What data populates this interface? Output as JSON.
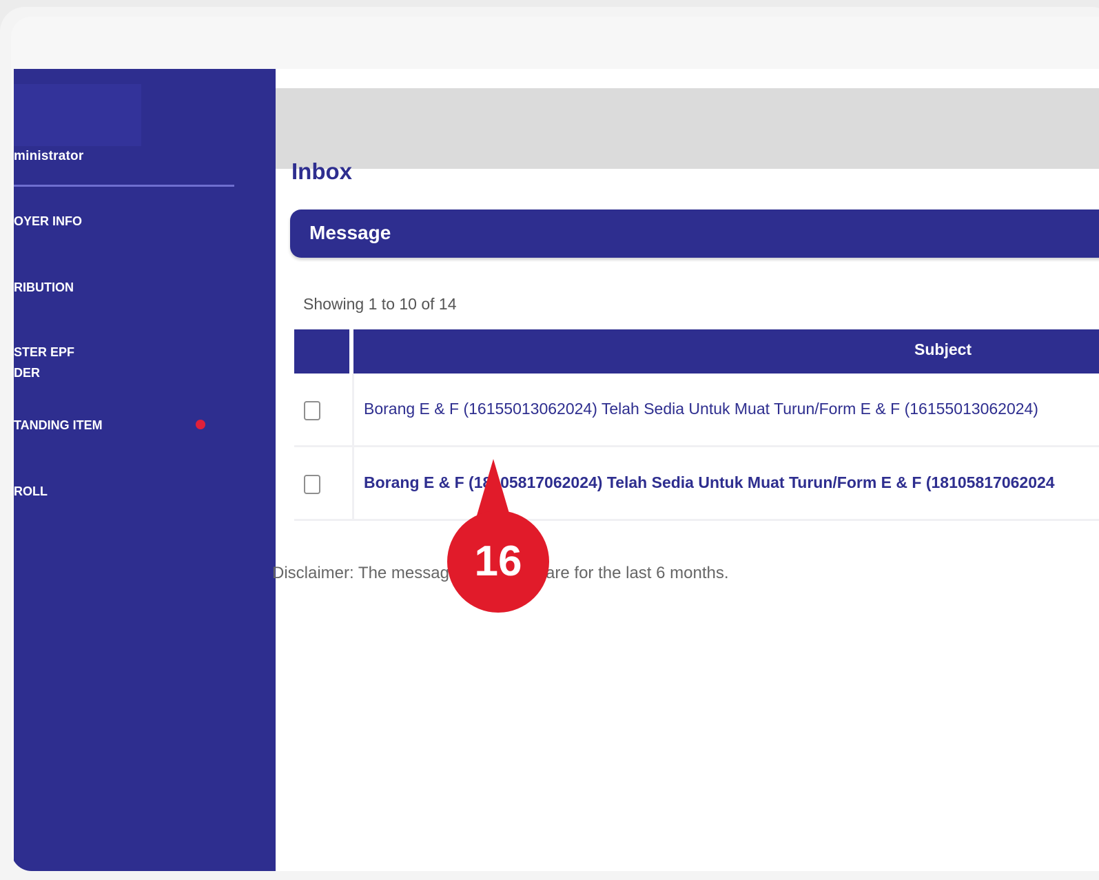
{
  "sidebar": {
    "user_role": "ministrator",
    "items": [
      {
        "label": "OYER INFO"
      },
      {
        "label": "RIBUTION"
      },
      {
        "label": "STER EPF\nDER"
      },
      {
        "label": "TANDING ITEM"
      },
      {
        "label": "ROLL"
      },
      {
        "label": ""
      },
      {
        "label": ""
      }
    ]
  },
  "main": {
    "title": "Inbox",
    "section_label": "Message",
    "showing": "Showing 1 to 10 of 14",
    "table": {
      "columns": [
        "",
        "Subject"
      ],
      "rows": [
        {
          "subject": "Borang E & F (16155013062024) Telah Sedia Untuk Muat Turun/Form E & F (16155013062024)",
          "unread": false
        },
        {
          "subject": "Borang E & F (18105817062024) Telah Sedia Untuk Muat Turun/Form E & F (18105817062024",
          "unread": true
        }
      ]
    },
    "disclaimer": "Disclaimer: The messages displayed are for the last 6 months."
  },
  "callout": {
    "number": "16",
    "color": "#e11b2a"
  },
  "colors": {
    "brand": "#2e2e8f",
    "alert": "#e0203a"
  }
}
